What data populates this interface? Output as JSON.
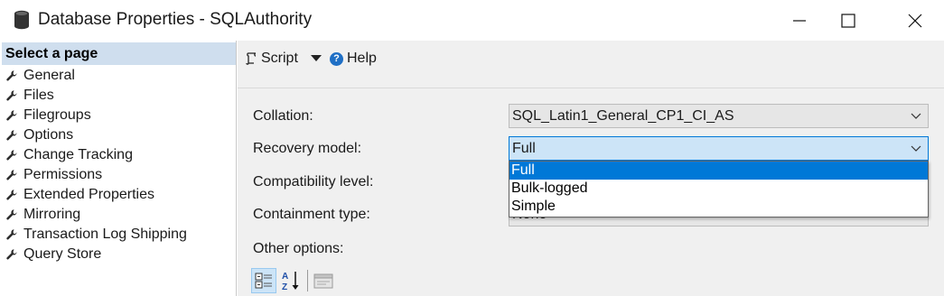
{
  "window": {
    "title": "Database Properties - SQLAuthority"
  },
  "left_panel": {
    "header": "Select a page",
    "items": [
      {
        "label": "General"
      },
      {
        "label": "Files"
      },
      {
        "label": "Filegroups"
      },
      {
        "label": "Options"
      },
      {
        "label": "Change Tracking"
      },
      {
        "label": "Permissions"
      },
      {
        "label": "Extended Properties"
      },
      {
        "label": "Mirroring"
      },
      {
        "label": "Transaction Log Shipping"
      },
      {
        "label": "Query Store"
      }
    ]
  },
  "toolbar": {
    "script_label": "Script",
    "help_label": "Help"
  },
  "form": {
    "collation": {
      "label": "Collation:",
      "value": "SQL_Latin1_General_CP1_CI_AS"
    },
    "recovery_model": {
      "label": "Recovery model:",
      "value": "Full"
    },
    "compatibility_level": {
      "label": "Compatibility level:",
      "value": ""
    },
    "containment_type": {
      "label": "Containment type:",
      "value": "None"
    },
    "other_options_label": "Other options:"
  },
  "recovery_dropdown": {
    "options": [
      "Full",
      "Bulk-logged",
      "Simple"
    ],
    "selected_index": 0
  },
  "colors": {
    "header_bg": "#cfdeee",
    "selection_blue": "#0078d7",
    "active_combo_bg": "#cce4f7",
    "panel_bg": "#f0f0f0"
  },
  "icons": {
    "title": "database-icon",
    "page_item": "wrench-icon",
    "script": "script-icon",
    "help": "help-icon",
    "categorized": "categorized-icon",
    "alphabetical": "sort-alphabetical-icon",
    "property_pages": "property-pages-icon"
  }
}
